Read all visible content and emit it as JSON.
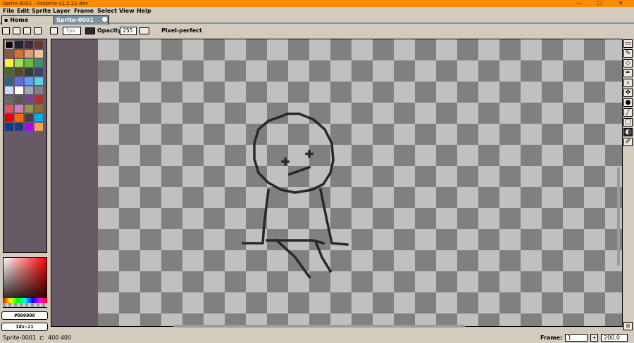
{
  "window": {
    "title": "Sprite-0001 - Aseprite v1.2.21-dev",
    "controls": [
      "—",
      "☐",
      "✕"
    ]
  },
  "menu": [
    "File",
    "Edit",
    "Sprite",
    "Layer",
    "Frame",
    "Select",
    "View",
    "Help"
  ],
  "tabs": {
    "home": "Home",
    "sprite": "Sprite-0001"
  },
  "context": {
    "brush_size": "3px",
    "opacity_label": "Opacity:",
    "opacity_value": "255",
    "pixel_perfect_label": "Pixel-perfect"
  },
  "palette": {
    "colors": [
      "#000000",
      "#222034",
      "#45283c",
      "#663931",
      "#8f563b",
      "#df7126",
      "#d9a066",
      "#eec39a",
      "#fbf236",
      "#99e550",
      "#6abe30",
      "#37946e",
      "#4b692f",
      "#524b24",
      "#323c39",
      "#3f3f74",
      "#306082",
      "#5b6ee1",
      "#639bff",
      "#5fcde4",
      "#cbdbfc",
      "#ffffff",
      "#9badb7",
      "#847e87",
      "#696a6a",
      "#595652",
      "#76428a",
      "#ac3232",
      "#d95763",
      "#d77bba",
      "#8f974a",
      "#8a6f30",
      "#e00000",
      "#ff6a00",
      "#404040",
      "#00a8ff",
      "#0a3c8c",
      "#203880",
      "#b000ff",
      "#ffa050"
    ],
    "foreground_hex": "#000000",
    "background_index": "Idx-21"
  },
  "canvas": {
    "background": "#665a64"
  },
  "tools": [
    "▭",
    "✎",
    "◇",
    "✒",
    "⌕",
    "✥",
    "●",
    "╱",
    "□",
    "◐",
    "✐"
  ],
  "status": {
    "sprite_name": "Sprite-0001",
    "dimensions": "400 400",
    "frame_label": "Frame:",
    "frame_value": "1",
    "zoom": "200.0"
  }
}
